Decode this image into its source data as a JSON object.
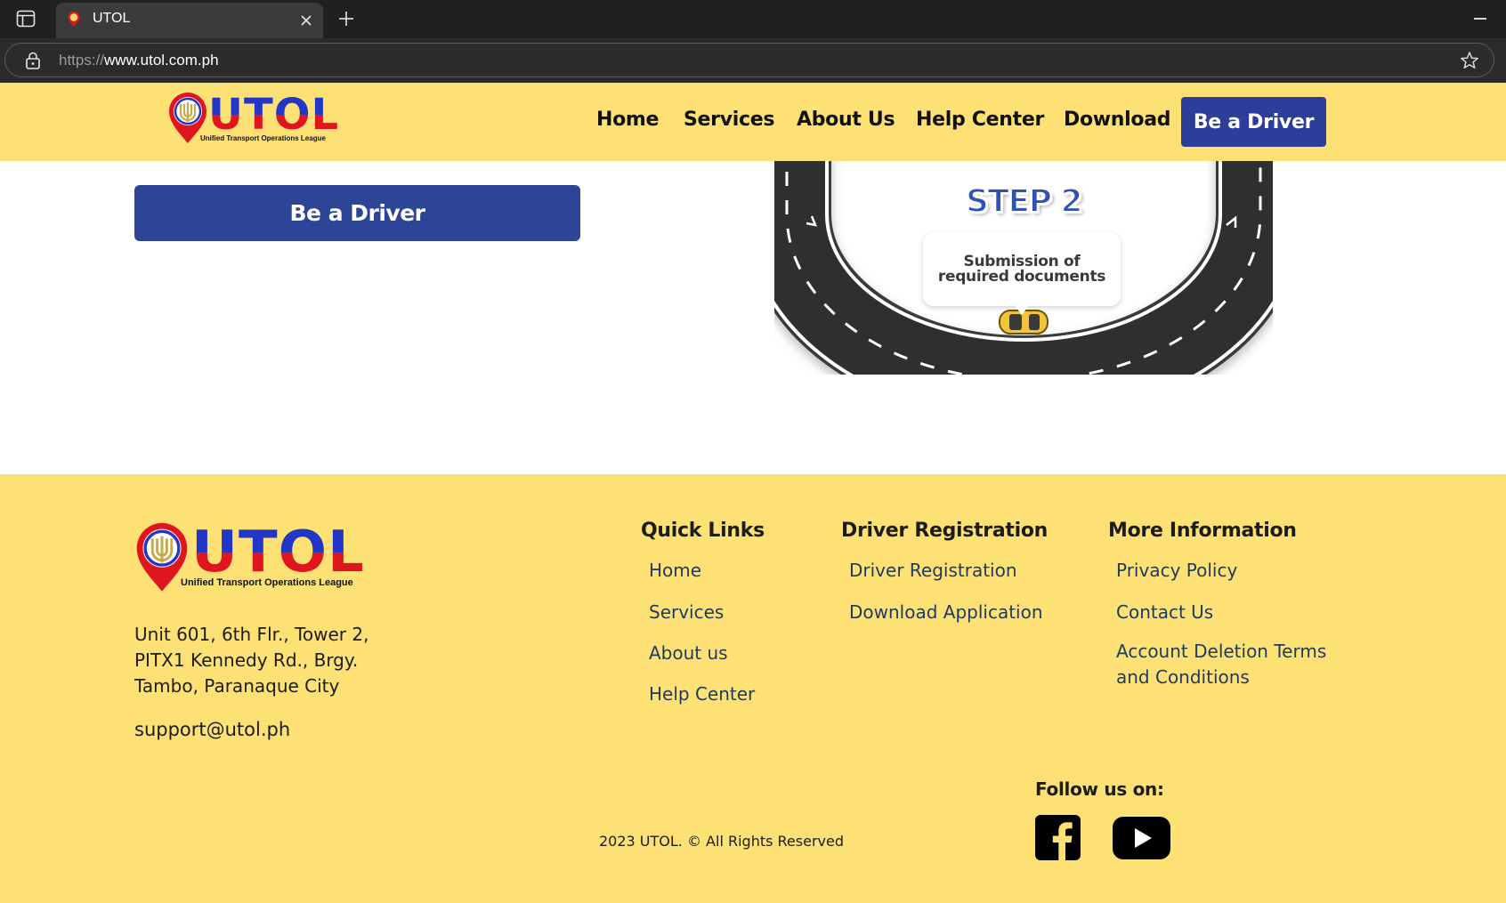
{
  "browser": {
    "tab_title": "UTOL",
    "url_scheme": "https://",
    "url_host": "www.utol.com.ph"
  },
  "brand": {
    "name": "UTOL",
    "tagline": "Unified Transport Operations League",
    "colors": {
      "yellow": "#fde174",
      "blue": "#2c3e99",
      "red": "#e0161e"
    }
  },
  "nav": {
    "links": [
      "Home",
      "Services",
      "About Us",
      "Help Center",
      "Download"
    ],
    "cta": "Be a Driver"
  },
  "main": {
    "cta": "Be a Driver",
    "step_title": "STEP 2",
    "step_text": "Submission of required documents"
  },
  "footer": {
    "address": [
      "Unit 601, 6th Flr., Tower 2,",
      "PITX1 Kennedy Rd., Brgy.",
      "Tambo, Paranaque City"
    ],
    "email": "support@utol.ph",
    "quick_links": {
      "title": "Quick Links",
      "items": [
        "Home",
        "Services",
        "About us",
        "Help Center"
      ]
    },
    "driver_registration": {
      "title": "Driver Registration",
      "items": [
        "Driver Registration",
        "Download Application"
      ]
    },
    "more_information": {
      "title": "More Information",
      "items": [
        "Privacy Policy",
        "Contact Us",
        "Account Deletion Terms and Conditions"
      ]
    },
    "follow_title": "Follow us on:",
    "social_icons": [
      "facebook-icon",
      "youtube-icon"
    ],
    "copyright": "2023 UTOL. © All Rights Reserved"
  }
}
